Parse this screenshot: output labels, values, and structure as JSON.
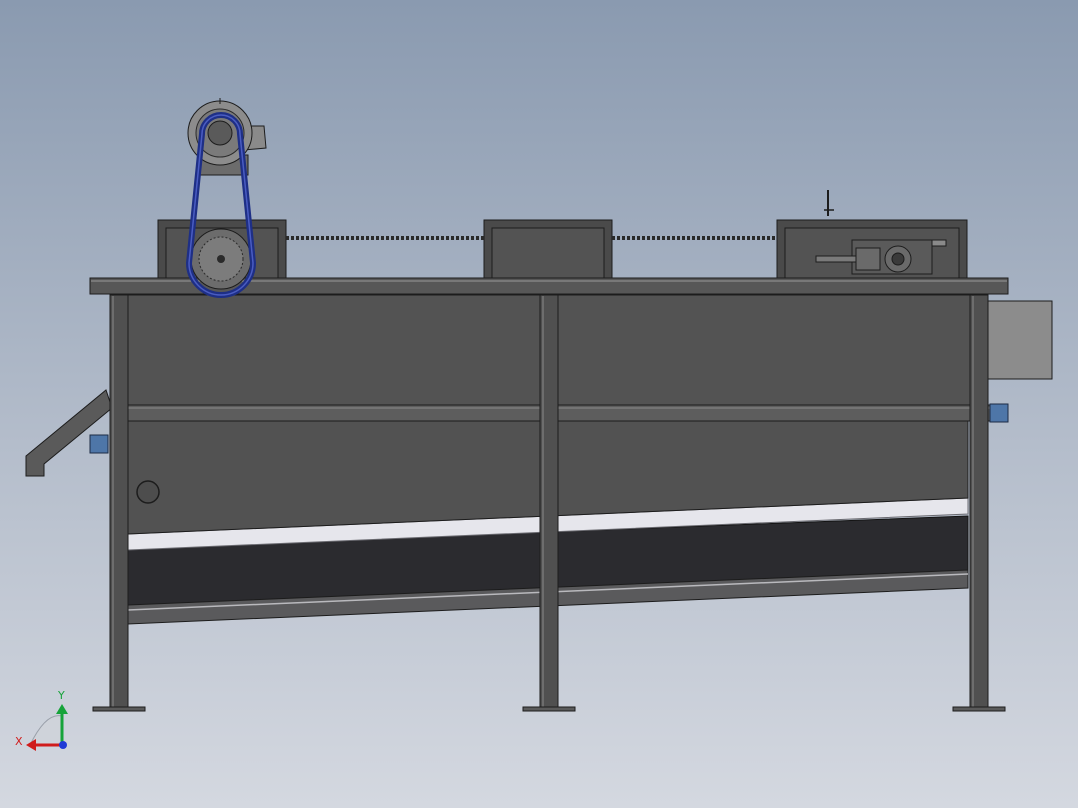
{
  "viewport": {
    "background_top": "#8a9ab0",
    "background_bottom": "#d4d8e0"
  },
  "triad": {
    "x_label": "X",
    "y_label": "Y",
    "x_color": "#d01c1c",
    "y_color": "#16a33a",
    "z_color": "#1f3ad6"
  },
  "model": {
    "frame_color": "#4f4f4f",
    "panel_color": "#535353",
    "edge_color": "#1c1c1c",
    "belt_color": "#1e2f86",
    "motor_color": "#8c8c8c",
    "mesh_color": "#e6e6ec",
    "pad_color": "#4e76a8"
  }
}
